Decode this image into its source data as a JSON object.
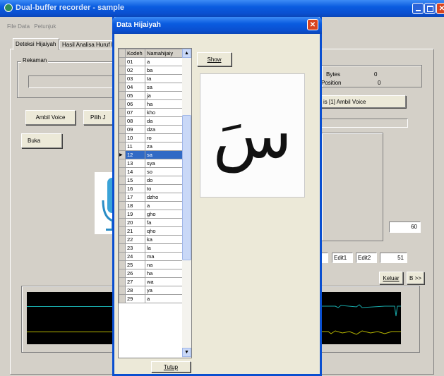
{
  "main_window": {
    "title": "Dual-buffer recorder - sample"
  },
  "menu": [
    "File Data",
    "Petunjuk"
  ],
  "tabs": [
    "Deteksi Hijaiyah",
    "Hasil Analisa Huruf H"
  ],
  "rekaman": {
    "group_label": "Rekaman",
    "ambil_voice": "Ambil Voice",
    "pilih": "Pilih J",
    "buka": "Buka"
  },
  "stats": {
    "bytes_label": "Bytes",
    "bytes_value": "0",
    "position_label": "Position",
    "position_value": "0"
  },
  "analysis_button": "is [1] Ambil Voice",
  "field_60": "60",
  "edit1": "Edit1",
  "edit2": "Edit2",
  "field_51": "51",
  "keluar": "Keluar",
  "next": "B >>",
  "dialog": {
    "title": "Data Hijaiyah",
    "col_kode": "Kodeh",
    "col_nama": "Namahijaiy",
    "show_button": "Show",
    "tutup_button": "Tutup",
    "glyph": "سَ",
    "rows": [
      {
        "kode": "01",
        "nama": "a"
      },
      {
        "kode": "02",
        "nama": "ba"
      },
      {
        "kode": "03",
        "nama": "ta"
      },
      {
        "kode": "04",
        "nama": "sa"
      },
      {
        "kode": "05",
        "nama": "ja"
      },
      {
        "kode": "06",
        "nama": "ha"
      },
      {
        "kode": "07",
        "nama": "kho"
      },
      {
        "kode": "08",
        "nama": "da"
      },
      {
        "kode": "09",
        "nama": "dza"
      },
      {
        "kode": "10",
        "nama": "ro"
      },
      {
        "kode": "11",
        "nama": "za"
      },
      {
        "kode": "12",
        "nama": "sa"
      },
      {
        "kode": "13",
        "nama": "sya"
      },
      {
        "kode": "14",
        "nama": "so"
      },
      {
        "kode": "15",
        "nama": "do"
      },
      {
        "kode": "16",
        "nama": "to"
      },
      {
        "kode": "17",
        "nama": "dzho"
      },
      {
        "kode": "18",
        "nama": "a"
      },
      {
        "kode": "19",
        "nama": "gho"
      },
      {
        "kode": "20",
        "nama": "fa"
      },
      {
        "kode": "21",
        "nama": "qho"
      },
      {
        "kode": "22",
        "nama": "ka"
      },
      {
        "kode": "23",
        "nama": "la"
      },
      {
        "kode": "24",
        "nama": "ma"
      },
      {
        "kode": "25",
        "nama": "na"
      },
      {
        "kode": "26",
        "nama": "ha"
      },
      {
        "kode": "27",
        "nama": "wa"
      },
      {
        "kode": "28",
        "nama": "ya"
      },
      {
        "kode": "29",
        "nama": "a"
      }
    ],
    "selected_index": 11
  }
}
